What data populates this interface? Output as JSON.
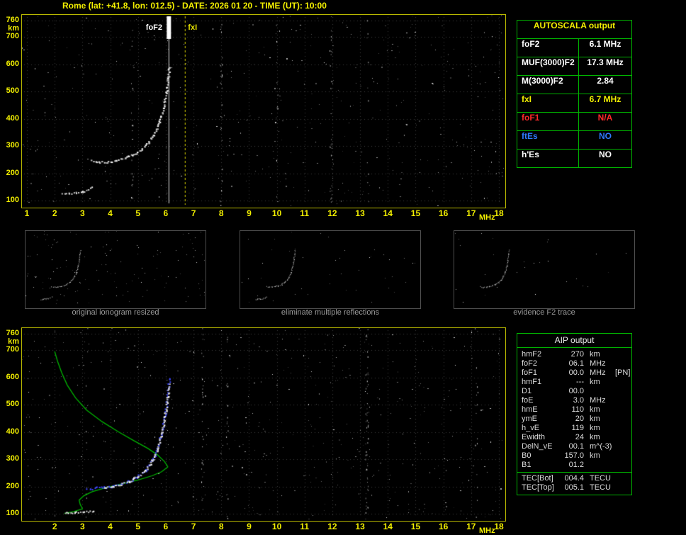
{
  "header": {
    "title": "Rome (lat: +41.8, lon: 012.5) - DATE: 2026 01 20 - TIME (UT): 10:00"
  },
  "colors": {
    "axis_yellow": "#f2ef00",
    "table_green": "#00b400",
    "alert_red": "#ff2a2a",
    "info_blue": "#2e7bff",
    "profile_green": "#00b400",
    "restored_blue": "#3c46ff",
    "caption_grey": "#9a9a9a"
  },
  "autoscala_table": {
    "title": "AUTOSCALA output",
    "rows": [
      {
        "label": "foF2",
        "value": "6.1 MHz",
        "color": "#ffffff"
      },
      {
        "label": "MUF(3000)F2",
        "value": "17.3 MHz",
        "color": "#ffffff"
      },
      {
        "label": "M(3000)F2",
        "value": "2.84",
        "color": "#ffffff"
      },
      {
        "label": "fxI",
        "value": "6.7 MHz",
        "color": "#f2ef00"
      },
      {
        "label": "foF1",
        "value": "N/A",
        "color": "#ff2a2a"
      },
      {
        "label": "ftEs",
        "value": "NO",
        "color": "#2e7bff"
      },
      {
        "label": "h'Es",
        "value": "NO",
        "color": "#ffffff"
      }
    ]
  },
  "thumbnails": [
    {
      "caption": "original ionogram resized"
    },
    {
      "caption": "eliminate multiple reflections"
    },
    {
      "caption": "evidence F2 trace"
    }
  ],
  "aip_table": {
    "title": "AIP output",
    "rows": [
      {
        "name": "hmF2",
        "value": "270",
        "unit": "km",
        "note": ""
      },
      {
        "name": "foF2",
        "value": "06.1",
        "unit": "MHz",
        "note": ""
      },
      {
        "name": "foF1",
        "value": "00.0",
        "unit": "MHz",
        "note": "[PN]"
      },
      {
        "name": "hmF1",
        "value": "---",
        "unit": "km",
        "note": ""
      },
      {
        "name": "D1",
        "value": "00.0",
        "unit": "",
        "note": ""
      },
      {
        "name": "foE",
        "value": "3.0",
        "unit": "MHz",
        "note": ""
      },
      {
        "name": "hmE",
        "value": "110",
        "unit": "km",
        "note": ""
      },
      {
        "name": "ymE",
        "value": "20",
        "unit": "km",
        "note": ""
      },
      {
        "name": "h_vE",
        "value": "119",
        "unit": "km",
        "note": ""
      },
      {
        "name": "Ewidth",
        "value": "24",
        "unit": "km",
        "note": ""
      },
      {
        "name": "DelN_vE",
        "value": "00.1",
        "unit": "m^(-3)",
        "note": ""
      },
      {
        "name": "B0",
        "value": "157.0",
        "unit": "km",
        "note": ""
      },
      {
        "name": "B1",
        "value": "01.2",
        "unit": "",
        "note": ""
      }
    ],
    "tec_rows": [
      {
        "name": "TEC[Bot]",
        "value": "004.4",
        "unit": "TECU"
      },
      {
        "name": "TEC[Top]",
        "value": "005.1",
        "unit": "TECU"
      }
    ]
  },
  "chart_data": [
    {
      "type": "scatter",
      "id": "ionogram_top",
      "xlabel": "MHz",
      "ylabel": "km",
      "xlim": [
        1,
        18
      ],
      "ylim": [
        100,
        760
      ],
      "x_ticks": [
        1,
        2,
        3,
        4,
        5,
        6,
        7,
        8,
        9,
        10,
        11,
        12,
        13,
        14,
        15,
        16,
        17,
        18
      ],
      "y_ticks": [
        760,
        700,
        600,
        500,
        400,
        300,
        200,
        100
      ],
      "grid": "dotted",
      "markers": {
        "fof2_label": "foF2",
        "fof2_mhz": 6.1,
        "fxi_label": "fxI",
        "fxi_mhz": 6.7
      },
      "traces": {
        "e_trace": [
          [
            2.25,
            126
          ],
          [
            2.5,
            128
          ],
          [
            2.75,
            130
          ],
          [
            3.0,
            134
          ],
          [
            3.2,
            141
          ],
          [
            3.35,
            150
          ]
        ],
        "f_trace": [
          [
            3.3,
            247
          ],
          [
            3.6,
            242
          ],
          [
            3.9,
            243
          ],
          [
            4.2,
            249
          ],
          [
            4.5,
            257
          ],
          [
            4.8,
            269
          ],
          [
            5.1,
            287
          ],
          [
            5.35,
            313
          ],
          [
            5.55,
            343
          ],
          [
            5.75,
            386
          ],
          [
            5.9,
            441
          ],
          [
            6.0,
            500
          ],
          [
            6.07,
            553
          ],
          [
            6.11,
            592
          ]
        ]
      }
    },
    {
      "type": "scatter",
      "id": "ionogram_bottom",
      "xlabel": "MHz",
      "ylabel": "km",
      "xlim": [
        1,
        18
      ],
      "ylim": [
        100,
        760
      ],
      "x_ticks": [
        2,
        3,
        4,
        5,
        6,
        7,
        8,
        9,
        10,
        11,
        12,
        13,
        14,
        15,
        16,
        17,
        18
      ],
      "y_ticks": [
        760,
        700,
        600,
        500,
        400,
        300,
        200,
        100
      ],
      "grid": "dotted",
      "traces": {
        "e_trace": [
          [
            2.35,
            104
          ],
          [
            2.7,
            106
          ],
          [
            3.05,
            108
          ],
          [
            3.4,
            111
          ]
        ],
        "f_trace": [
          [
            3.75,
            199
          ],
          [
            4.05,
            202
          ],
          [
            4.35,
            209
          ],
          [
            4.65,
            220
          ],
          [
            4.95,
            236
          ],
          [
            5.25,
            260
          ],
          [
            5.5,
            296
          ],
          [
            5.7,
            342
          ],
          [
            5.85,
            402
          ],
          [
            5.97,
            468
          ],
          [
            6.05,
            528
          ],
          [
            6.1,
            575
          ]
        ],
        "restored": [
          [
            3.15,
            193
          ],
          [
            3.45,
            195
          ],
          [
            3.75,
            199
          ],
          [
            4.05,
            202
          ],
          [
            4.35,
            209
          ],
          [
            4.65,
            220
          ],
          [
            4.95,
            236
          ],
          [
            5.25,
            260
          ],
          [
            5.5,
            296
          ],
          [
            5.7,
            342
          ],
          [
            5.85,
            402
          ],
          [
            5.97,
            468
          ],
          [
            6.05,
            528
          ],
          [
            6.1,
            575
          ],
          [
            6.12,
            600
          ]
        ],
        "profile_topside": [
          [
            6.08,
            272
          ],
          [
            5.95,
            292
          ],
          [
            5.7,
            316
          ],
          [
            5.35,
            340
          ],
          [
            4.85,
            368
          ],
          [
            4.3,
            400
          ],
          [
            3.7,
            438
          ],
          [
            3.15,
            480
          ],
          [
            2.75,
            525
          ],
          [
            2.45,
            572
          ],
          [
            2.25,
            618
          ],
          [
            2.1,
            660
          ],
          [
            2.0,
            695
          ]
        ],
        "profile_bottomside": [
          [
            6.08,
            272
          ],
          [
            5.85,
            254
          ],
          [
            5.5,
            239
          ],
          [
            5.0,
            224
          ],
          [
            4.45,
            210
          ],
          [
            3.85,
            196
          ],
          [
            3.35,
            181
          ],
          [
            3.05,
            166
          ],
          [
            2.88,
            150
          ],
          [
            2.92,
            134
          ],
          [
            3.0,
            118
          ],
          [
            2.7,
            108
          ],
          [
            2.35,
            101
          ]
        ]
      }
    }
  ]
}
